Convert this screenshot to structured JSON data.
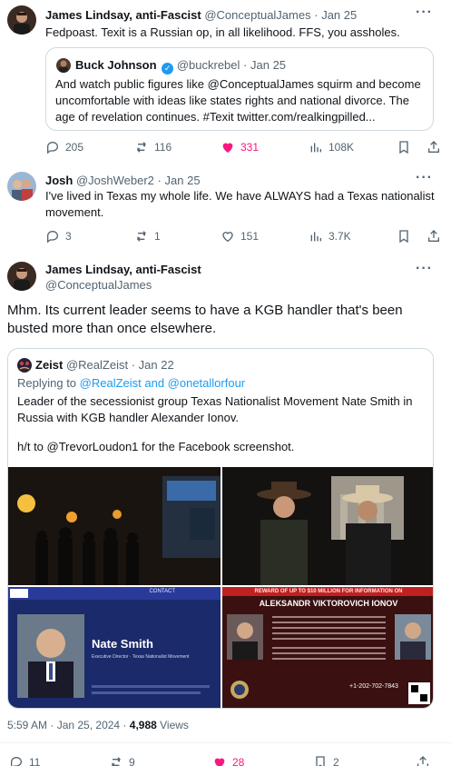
{
  "tweet1": {
    "name": "James Lindsay, anti-Fascist",
    "handle": "@ConceptualJames",
    "date": "Jan 25",
    "text": "Fedpoast. Texit is a Russian op, in all likelihood. FFS, you assholes.",
    "quote": {
      "name": "Buck Johnson",
      "handle": "@buckrebel",
      "date": "Jan 25",
      "text": "And watch public figures like @ConceptualJames squirm and become uncomfortable with ideas like states rights and national divorce. The age of revelation continues. #Texit twitter.com/realkingpilled..."
    },
    "stats": {
      "replies": "205",
      "reposts": "116",
      "likes": "331",
      "views": "108K"
    }
  },
  "tweet2": {
    "name": "Josh",
    "handle": "@JoshWeber2",
    "date": "Jan 25",
    "text": "I've lived in Texas my whole life. We have ALWAYS had a Texas nationalist movement.",
    "stats": {
      "replies": "3",
      "reposts": "1",
      "likes": "151",
      "views": "3.7K"
    }
  },
  "main": {
    "name": "James Lindsay, anti-Fascist",
    "handle": "@ConceptualJames",
    "text": "Mhm. Its current leader seems to have a KGB handler that's been busted more than once elsewhere.",
    "quote": {
      "name": "Zeist",
      "handle": "@RealZeist",
      "date": "Jan 22",
      "replying_prefix": "Replying to ",
      "replying_to": "@RealZeist and @onetallorfour",
      "text_line1": "Leader of the secessionist group Texas Nationalist Movement Nate Smith in Russia with KGB handler Alexander Ionov.",
      "text_line2_prefix": "h/t to ",
      "text_line2_mention": "@TrevorLoudon1",
      "text_line2_suffix": " for the Facebook screenshot.",
      "images": {
        "img3_header": "CONTACT",
        "img3_name": "Nate Smith",
        "img3_role": "Executive Director · Texas Nationalist Movement",
        "img4_banner": "REWARD OF UP TO $10 MILLION FOR INFORMATION ON",
        "img4_name": "ALEKSANDR VIKTOROVICH IONOV",
        "img4_phone": "+1-202-702-7843"
      }
    },
    "timestamp": "5:59 AM · Jan 25, 2024",
    "separator": " · ",
    "views_count": "4,988",
    "views_label": " Views",
    "stats": {
      "replies": "11",
      "reposts": "9",
      "likes": "28",
      "bookmarks": "2"
    }
  },
  "colors": {
    "like_pink": "#f91880",
    "link_blue": "#1d9bf0",
    "muted": "#536471",
    "border": "#cfd9de"
  },
  "more_label": "···"
}
